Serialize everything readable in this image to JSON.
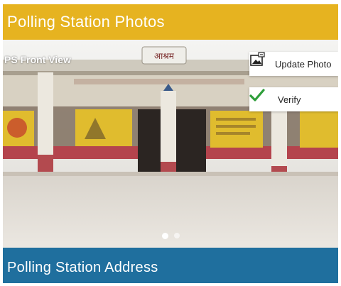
{
  "header": {
    "title": "Polling Station Photos"
  },
  "photo": {
    "label": "PS Front View",
    "sign_text": "आश्रम",
    "carousel": {
      "count": 2,
      "active": 0
    }
  },
  "actions": {
    "update_label": "Update Photo",
    "update_icon": "image-edit-icon",
    "verify_label": "Verify",
    "verify_icon": "checkmark-icon"
  },
  "footer": {
    "title": "Polling Station Address"
  },
  "colors": {
    "header_bg": "#e6b320",
    "footer_bg": "#1f6f9e",
    "verify_check": "#2e9e3a"
  }
}
